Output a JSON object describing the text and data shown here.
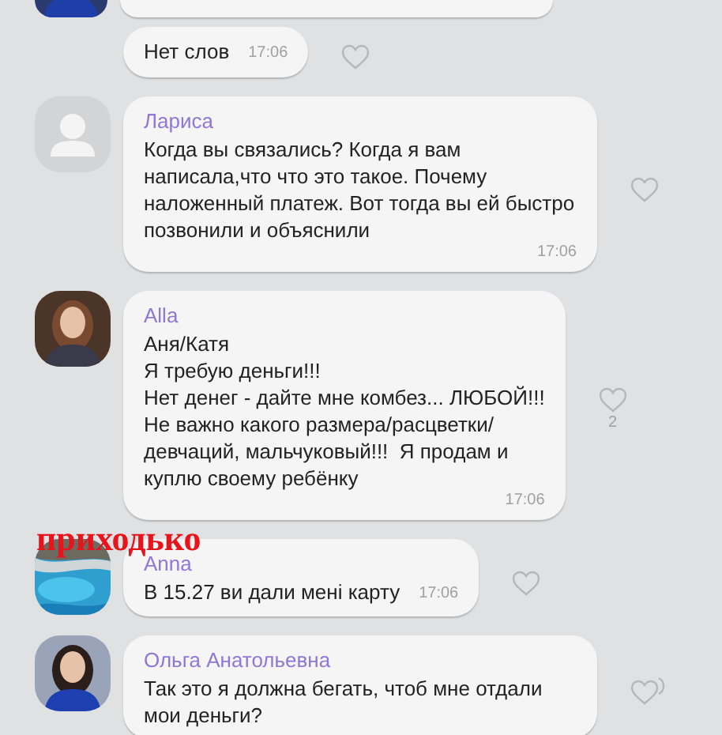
{
  "messages": [
    {
      "kind": "cut"
    },
    {
      "kind": "continuation",
      "text": "Нет слов",
      "time": "17:06"
    },
    {
      "kind": "block",
      "avatar": {
        "kind": "default"
      },
      "name": "Лариса",
      "text": "Когда вы связались? Когда я вам написала,что что это такое. Почему наложенный платеж. Вот тогда вы ей быстро позвонили и объяснили",
      "time": "17:06"
    },
    {
      "kind": "block",
      "name": "Alla",
      "text": "Аня/Катя\nЯ требую деньги!!!\nНет денег - дайте мне комбез... ЛЮБОЙ!!!\nНе важно какого размера/расцветки/\nдевчаций, мальчуковый!!!  Я продам и\nкуплю своему ребёнку",
      "time": "17:06",
      "likes": "2"
    },
    {
      "kind": "inline",
      "name": "Anna",
      "text": "В 15.27 ви дали мені карту",
      "time": "17:06",
      "annotation": "приходько"
    },
    {
      "kind": "block",
      "name": "Ольга Анатольевна",
      "text": "Так это я должна бегать, чтоб мне отдали мои деньги?",
      "side_mark": true
    }
  ]
}
